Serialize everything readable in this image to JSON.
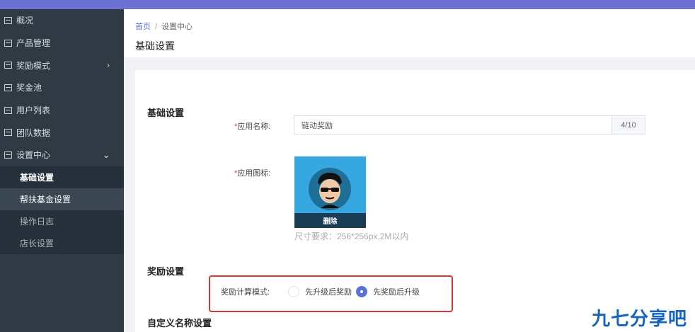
{
  "sidebar": {
    "items": [
      {
        "label": "概况"
      },
      {
        "label": "产品管理"
      },
      {
        "label": "奖励模式",
        "arrow": "›"
      },
      {
        "label": "奖金池"
      },
      {
        "label": "用户列表"
      },
      {
        "label": "团队数据"
      },
      {
        "label": "设置中心",
        "arrow": "⌄"
      }
    ],
    "sub_items": [
      {
        "label": "基础设置"
      },
      {
        "label": "帮扶基金设置"
      },
      {
        "label": "操作日志"
      },
      {
        "label": "店长设置"
      }
    ]
  },
  "breadcrumb": {
    "home": "首页",
    "separator": "/",
    "current": "设置中心"
  },
  "page_title": "基础设置",
  "basic": {
    "section_title": "基础设置",
    "app_name_required": "*",
    "app_name_label": "应用名称:",
    "app_name_value": "链动奖励",
    "app_name_counter": "4/10",
    "app_icon_required": "*",
    "app_icon_label": "应用图标:",
    "delete_label": "删除",
    "size_hint": "尺寸要求：256*256px,2M以内"
  },
  "reward": {
    "section_title": "奖励设置",
    "mode_label": "奖励计算模式:",
    "options": [
      {
        "label": "先升级后奖励",
        "checked": false
      },
      {
        "label": "先奖励后升级",
        "checked": true
      }
    ]
  },
  "custom": {
    "section_title": "自定义名称设置"
  },
  "watermark": "九七分享吧",
  "colors": {
    "accent": "#5a72d4",
    "sidebar_bg": "#2f3a45",
    "highlight": "#d23a3a",
    "watermark": "#1565c0"
  }
}
